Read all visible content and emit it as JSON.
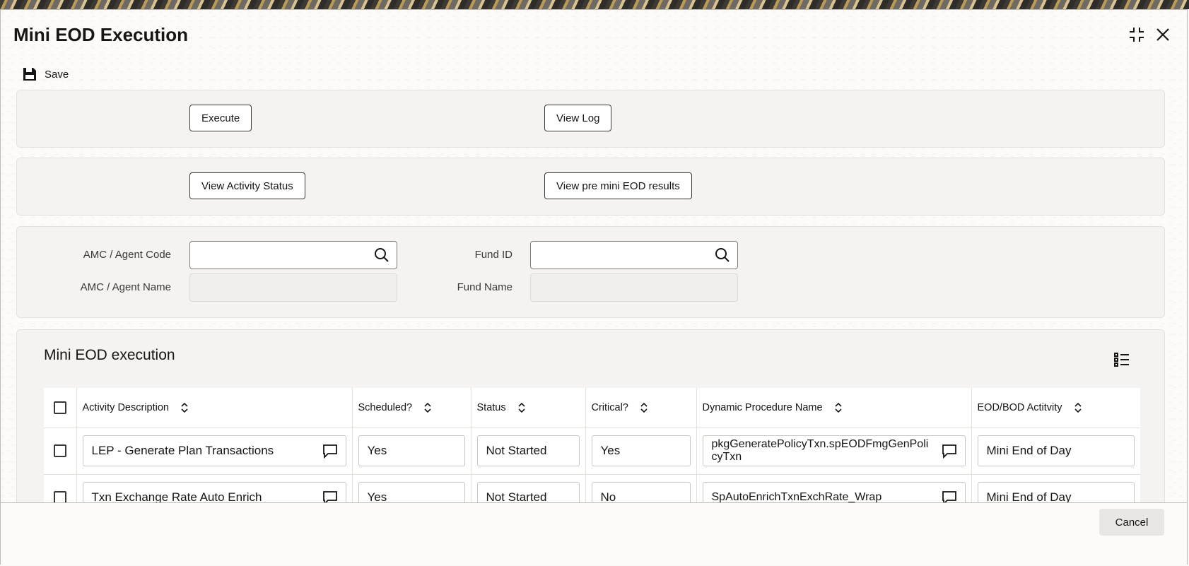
{
  "window": {
    "title": "Mini EOD Execution"
  },
  "toolbar": {
    "save_label": "Save"
  },
  "actions_row1": {
    "execute_label": "Execute",
    "view_log_label": "View Log"
  },
  "actions_row2": {
    "view_activity_status_label": "View Activity Status",
    "view_pre_results_label": "View pre mini EOD results"
  },
  "form": {
    "amc_agent_code_label": "AMC / Agent Code",
    "amc_agent_code_value": "",
    "amc_agent_name_label": "AMC / Agent Name",
    "amc_agent_name_value": "",
    "fund_id_label": "Fund ID",
    "fund_id_value": "",
    "fund_name_label": "Fund Name",
    "fund_name_value": ""
  },
  "grid": {
    "title": "Mini EOD execution",
    "columns": [
      "Activity Description",
      "Scheduled?",
      "Status",
      "Critical?",
      "Dynamic Procedure Name",
      "EOD/BOD Actitvity"
    ],
    "rows": [
      {
        "activity_description": "LEP - Generate Plan Transactions",
        "scheduled": "Yes",
        "status": "Not Started",
        "critical": "Yes",
        "dynamic_procedure_name": "pkgGeneratePolicyTxn.spEODFmgGenPolicyTxn",
        "eod_bod_activity": "Mini End of Day"
      },
      {
        "activity_description": "Txn Exchange Rate Auto Enrich",
        "scheduled": "Yes",
        "status": "Not Started",
        "critical": "No",
        "dynamic_procedure_name": "SpAutoEnrichTxnExchRate_Wrap",
        "eod_bod_activity": "Mini End of Day"
      }
    ]
  },
  "footer": {
    "cancel_label": "Cancel"
  }
}
